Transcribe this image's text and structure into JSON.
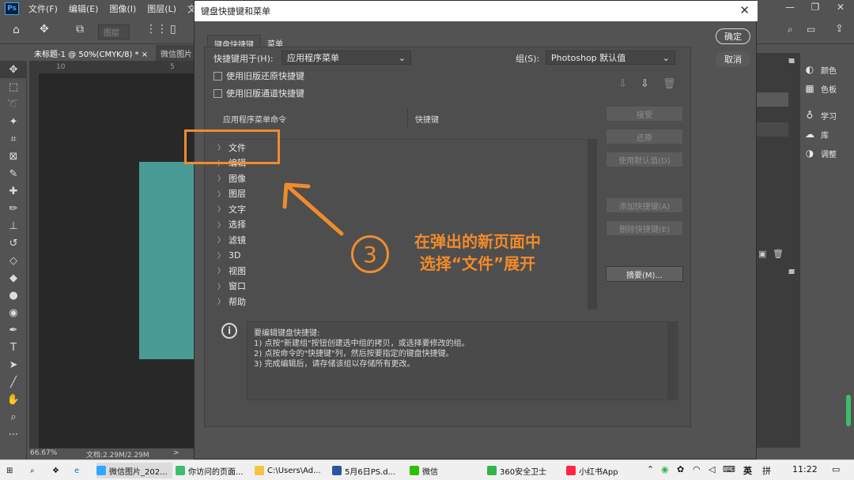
{
  "app": {
    "logo": "Ps",
    "menu": [
      "文件(F)",
      "编辑(E)",
      "图像(I)",
      "图层(L)",
      "文字("
    ],
    "window_controls": [
      "—",
      "❐",
      "✕"
    ]
  },
  "options_bar": {
    "layer_field": "图层"
  },
  "doc_tabs": [
    {
      "label": "未标题-1 @ 50%(CMYK/8) *",
      "close": "×"
    },
    {
      "label": "微信图片"
    }
  ],
  "ruler": {
    "ticks": [
      "10",
      "5"
    ]
  },
  "status": {
    "zoom": "66.67%",
    "doc": "文档:2.29M/2.29M",
    "arrow": ">"
  },
  "right_panel": {
    "items": [
      {
        "icon": "color-icon",
        "label": "颜色"
      },
      {
        "icon": "swatches-icon",
        "label": "色板"
      },
      {
        "icon": "learn-icon",
        "label": "学习"
      },
      {
        "icon": "library-icon",
        "label": "库"
      },
      {
        "icon": "adjust-icon",
        "label": "调整"
      }
    ]
  },
  "dialog": {
    "title": "键盘快捷键和菜单",
    "tabs": [
      "键盘快捷键",
      "菜单"
    ],
    "shortcuts_for_label": "快捷键用于(H):",
    "shortcuts_for_value": "应用程序菜单",
    "set_label": "组(S):",
    "set_value": "Photoshop 默认值",
    "checkbox_legacy_undo": "使用旧版还原快捷键",
    "checkbox_legacy_channel": "使用旧版通道快捷键",
    "col_command": "应用程序菜单命令",
    "col_shortcut": "快捷键",
    "menu_rows": [
      "文件",
      "编辑",
      "图像",
      "图层",
      "文字",
      "选择",
      "滤镜",
      "3D",
      "视图",
      "窗口",
      "帮助"
    ],
    "buttons": {
      "ok": "确定",
      "cancel": "取消",
      "accept": "接受",
      "undo": "还原",
      "use_default": "使用默认值(D)",
      "add_shortcut": "添加快捷键(A)",
      "delete_shortcut": "删除快捷键(E)",
      "summarize": "摘要(M)..."
    },
    "info_lines": [
      "要编辑键盘快捷键:",
      "1) 点按\"新建组\"按钮创建选中组的拷贝，或选择要修改的组。",
      "2) 点按命令的\"快捷键\"列，然后按要指定的键盘快捷键。",
      "3) 完成编辑后，请存储该组以存储所有更改。"
    ]
  },
  "annotation": {
    "number": "3",
    "line1": "在弹出的新页面中",
    "line2": "选择“文件”展开",
    "color": "#f08c2e"
  },
  "taskbar": {
    "items": [
      {
        "label": "微信图片_202...",
        "color": "#31a8ff"
      },
      {
        "label": "你访问的页面...",
        "color": "#3dbd6e"
      },
      {
        "label": "C:\\Users\\Ad...",
        "color": "#f5c542"
      },
      {
        "label": "5月6日PS.d...",
        "color": "#2b579a"
      },
      {
        "label": "微信",
        "color": "#2dc100"
      },
      {
        "label": "360安全卫士",
        "color": "#36b24a"
      },
      {
        "label": "小红书App",
        "color": "#ff2442"
      }
    ],
    "ime": "英",
    "ime2": "拼",
    "time": "11:22"
  }
}
